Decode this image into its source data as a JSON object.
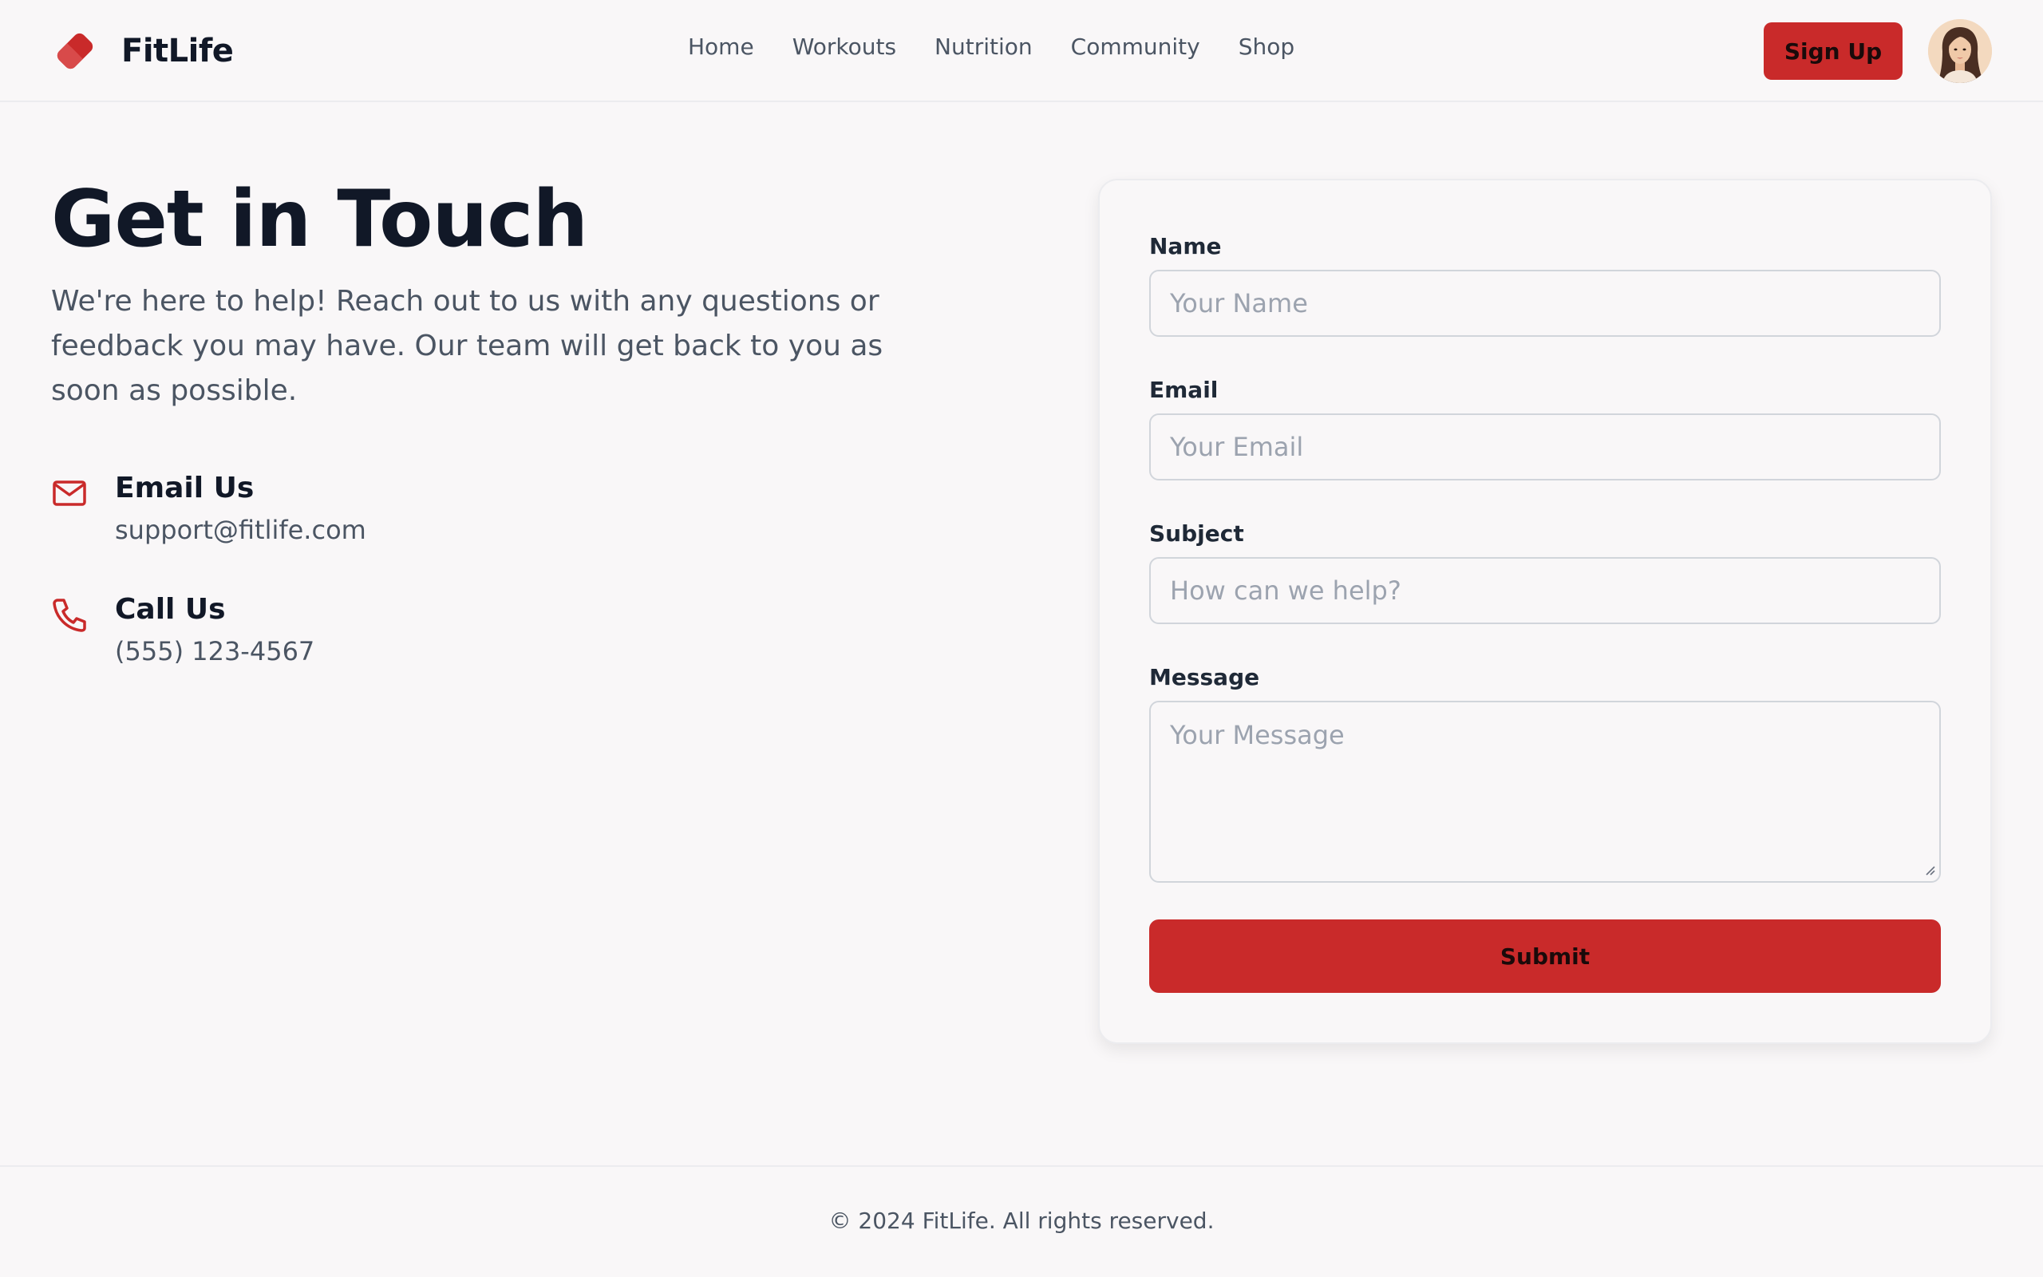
{
  "colors": {
    "accent": "#c92a2a",
    "background": "#f9f7f8",
    "heading": "#111827",
    "body_text": "#4b5563",
    "placeholder": "#9ca3af",
    "border": "#d1d5db"
  },
  "header": {
    "brand": {
      "name": "FitLife",
      "logo_icon": "dumbbell-weight-icon"
    },
    "nav": [
      {
        "label": "Home"
      },
      {
        "label": "Workouts"
      },
      {
        "label": "Nutrition"
      },
      {
        "label": "Community"
      },
      {
        "label": "Shop"
      }
    ],
    "signup_label": "Sign Up",
    "avatar_icon": "user-avatar"
  },
  "main": {
    "title": "Get in Touch",
    "intro": "We're here to help! Reach out to us with any questions or feedback you may have. Our team will get back to you as soon as possible.",
    "contacts": [
      {
        "icon": "mail-icon",
        "title": "Email Us",
        "value": "support@fitlife.com"
      },
      {
        "icon": "phone-icon",
        "title": "Call Us",
        "value": "(555) 123-4567"
      }
    ]
  },
  "form": {
    "name": {
      "label": "Name",
      "value": "",
      "placeholder": "Your Name"
    },
    "email": {
      "label": "Email",
      "value": "",
      "placeholder": "Your Email"
    },
    "subject": {
      "label": "Subject",
      "value": "",
      "placeholder": "How can we help?"
    },
    "message": {
      "label": "Message",
      "value": "",
      "placeholder": "Your Message"
    },
    "submit_label": "Submit"
  },
  "footer": {
    "text": "© 2024 FitLife. All rights reserved."
  }
}
